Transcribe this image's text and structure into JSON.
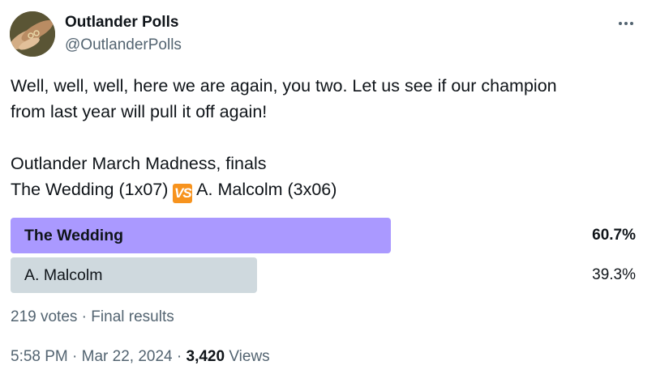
{
  "author": {
    "name": "Outlander Polls",
    "handle": "@OutlanderPolls",
    "avatar_icon": "hands-with-rings-avatar"
  },
  "tweet": {
    "line1": "Well, well, well, here we are again, you two. Let us see if our champion",
    "line2": "from last year will pull it off again!",
    "line3": "Outlander March Madness, finals",
    "line4_pre": "The Wedding (1x07) ",
    "vs_emoji": "VS",
    "line4_post": " A. Malcolm (3x06)"
  },
  "poll": {
    "options": [
      {
        "label": "The Wedding",
        "percent_text": "60.7%",
        "percent": 60.7,
        "winner": true,
        "color": "#aa99ff"
      },
      {
        "label": "A. Malcolm",
        "percent_text": "39.3%",
        "percent": 39.3,
        "winner": false,
        "color": "#cfd9de"
      }
    ],
    "votes": "219 votes",
    "separator": " · ",
    "status": "Final results"
  },
  "meta": {
    "time": "5:58 PM",
    "separator": " · ",
    "date": "Mar 22, 2024",
    "views_count": "3,420",
    "views_label": " Views"
  }
}
